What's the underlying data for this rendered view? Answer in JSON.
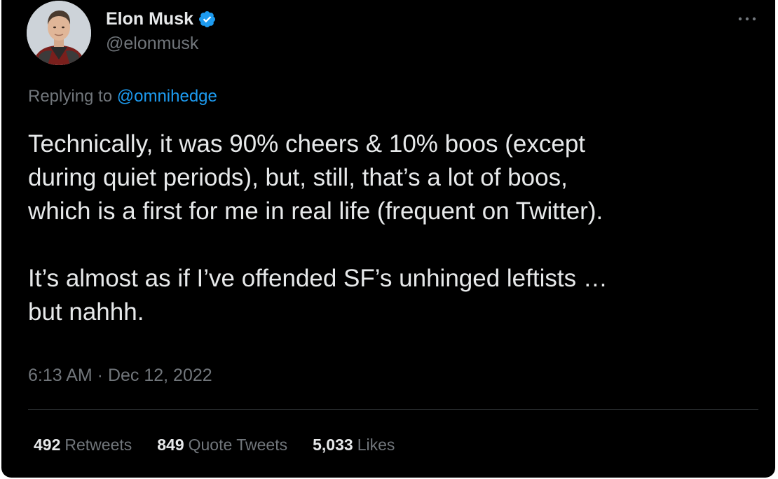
{
  "tweet": {
    "author": {
      "display_name": "Elon Musk",
      "handle": "@elonmusk",
      "verified": true,
      "avatar_icon": "profile-photo"
    },
    "more_icon": "more-dots-icon",
    "reply_context": {
      "prefix": "Replying to ",
      "mention": "@omnihedge"
    },
    "text": "Technically, it was 90% cheers & 10% boos (except\nduring quiet periods), but, still, that’s a lot of boos,\nwhich is a first for me in real life (frequent on Twitter).\n\nIt’s almost as if I’ve offended SF’s unhinged leftists …\nbut nahhh.",
    "timestamp": "6:13 AM · Dec 12, 2022",
    "stats": {
      "retweets": {
        "count": "492",
        "label": "Retweets"
      },
      "quote_tweets": {
        "count": "849",
        "label": "Quote Tweets"
      },
      "likes": {
        "count": "5,033",
        "label": "Likes"
      }
    }
  },
  "colors": {
    "background": "#000000",
    "primary_text": "#e7e9ea",
    "secondary_text": "#71767b",
    "accent": "#1d9bf0",
    "divider": "#2f3336"
  }
}
